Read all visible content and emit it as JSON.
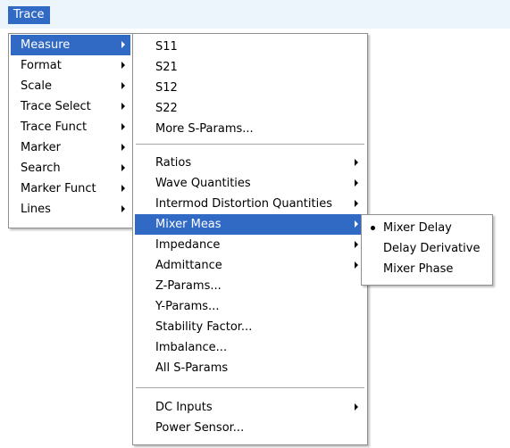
{
  "menubar": {
    "title": "Trace"
  },
  "trace_menu": {
    "items": [
      {
        "label": "Measure",
        "selected": true
      },
      {
        "label": "Format"
      },
      {
        "label": "Scale"
      },
      {
        "label": "Trace Select"
      },
      {
        "label": "Trace Funct"
      },
      {
        "label": "Marker"
      },
      {
        "label": "Search"
      },
      {
        "label": "Marker Funct"
      },
      {
        "label": "Lines"
      }
    ]
  },
  "measure_menu": {
    "items": [
      {
        "label": "S11"
      },
      {
        "label": "S21"
      },
      {
        "label": "S12"
      },
      {
        "label": "S22"
      },
      {
        "label": "More S-Params..."
      },
      {
        "label": "Ratios"
      },
      {
        "label": "Wave Quantities"
      },
      {
        "label": "Intermod Distortion Quantities"
      },
      {
        "label": "Mixer Meas",
        "selected": true
      },
      {
        "label": "Impedance"
      },
      {
        "label": "Admittance"
      },
      {
        "label": "Z-Params..."
      },
      {
        "label": "Y-Params..."
      },
      {
        "label": "Stability Factor..."
      },
      {
        "label": "Imbalance..."
      },
      {
        "label": "All S-Params"
      },
      {
        "label": "DC Inputs"
      },
      {
        "label": "Power Sensor..."
      }
    ]
  },
  "mixer_meas_menu": {
    "items": [
      {
        "label": "Mixer Delay",
        "checked": true
      },
      {
        "label": "Delay Derivative"
      },
      {
        "label": "Mixer Phase"
      }
    ]
  },
  "colors": {
    "highlight": "#316ac5",
    "menubar_bg": "#ecf5fb",
    "menu_border": "#8e8f8f"
  }
}
